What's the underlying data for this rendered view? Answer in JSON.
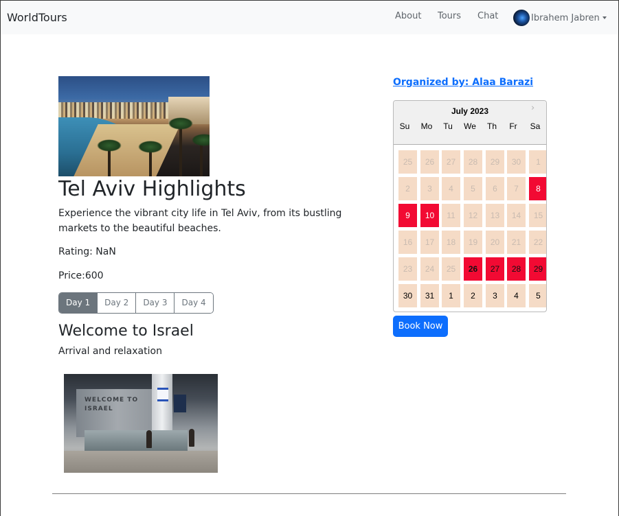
{
  "navbar": {
    "brand": "WorldTours",
    "links": [
      "About",
      "Tours",
      "Chat"
    ],
    "user_name": "Ibrahem Jabren"
  },
  "tour": {
    "title": "Tel Aviv Highlights",
    "description": "Experience the vibrant city life in Tel Aviv, from its bustling markets to the beautiful beaches.",
    "rating": "Rating: NaN",
    "price": "Price:600",
    "days": [
      "Day 1",
      "Day 2",
      "Day 3",
      "Day 4"
    ],
    "active_day": "Day 1",
    "day_title": "Welcome to Israel",
    "day_description": "Arrival and relaxation",
    "airport_sign": "WELCOME TO ISRAEL"
  },
  "organizer": "Organized by: Alaa Barazi",
  "calendar": {
    "month": "July 2023",
    "weekdays": [
      "Su",
      "Mo",
      "Tu",
      "We",
      "Th",
      "Fr",
      "Sa"
    ],
    "weeks": [
      [
        "25",
        "26",
        "27",
        "28",
        "29",
        "30",
        "1"
      ],
      [
        "2",
        "3",
        "4",
        "5",
        "6",
        "7",
        "8"
      ],
      [
        "9",
        "10",
        "11",
        "12",
        "13",
        "14",
        "15"
      ],
      [
        "16",
        "17",
        "18",
        "19",
        "20",
        "21",
        "22"
      ],
      [
        "23",
        "24",
        "25",
        "26",
        "27",
        "28",
        "29"
      ],
      [
        "30",
        "31",
        "1",
        "2",
        "3",
        "4",
        "5"
      ]
    ],
    "colors": {
      "disabled": "#f5dbc6",
      "highlight": "#f20a33"
    }
  },
  "book_button": "Book Now"
}
